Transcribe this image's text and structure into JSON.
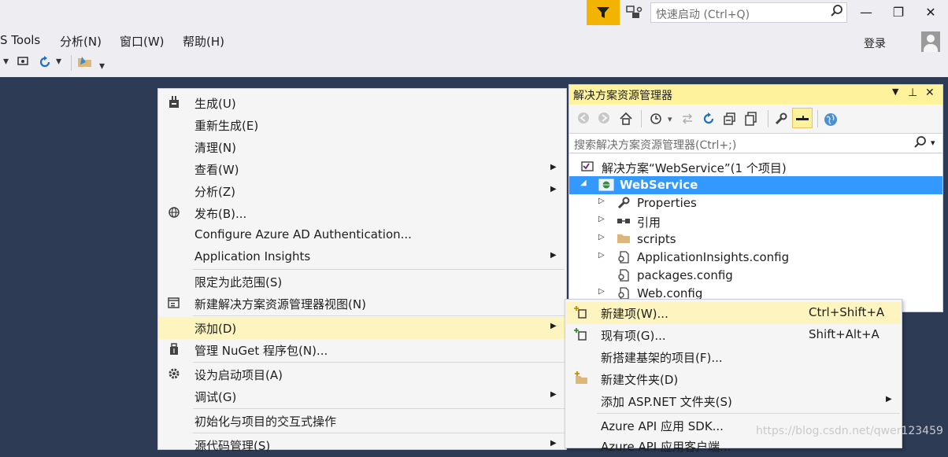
{
  "titlebar": {
    "quick_launch_placeholder": "快速启动 (Ctrl+Q)",
    "login_label": "登录",
    "minimize": "—",
    "maximize": "❐",
    "close": "✕"
  },
  "menubar": [
    "S Tools",
    "分析(N)",
    "窗口(W)",
    "帮助(H)"
  ],
  "context_menu": {
    "items": [
      {
        "label": "生成(U)",
        "icon": "build-icon",
        "arrow": ""
      },
      {
        "label": "重新生成(E)",
        "icon": "",
        "arrow": ""
      },
      {
        "label": "清理(N)",
        "icon": "",
        "arrow": ""
      },
      {
        "label": "查看(W)",
        "icon": "",
        "arrow": "▶"
      },
      {
        "label": "分析(Z)",
        "icon": "",
        "arrow": "▶"
      },
      {
        "label": "发布(B)...",
        "icon": "publish-globe-icon",
        "arrow": ""
      },
      {
        "label": "Configure Azure AD Authentication...",
        "icon": "",
        "arrow": ""
      },
      {
        "label": "Application Insights",
        "icon": "",
        "arrow": "▶"
      },
      {
        "label": "限定为此范围(S)",
        "icon": "",
        "arrow": ""
      },
      {
        "label": "新建解决方案资源管理器视图(N)",
        "icon": "new-view-icon",
        "arrow": ""
      },
      {
        "label": "添加(D)",
        "icon": "",
        "arrow": "▶"
      },
      {
        "label": "管理 NuGet 程序包(N)...",
        "icon": "nuget-icon",
        "arrow": ""
      },
      {
        "label": "设为启动项目(A)",
        "icon": "gear-icon",
        "arrow": ""
      },
      {
        "label": "调试(G)",
        "icon": "",
        "arrow": "▶"
      },
      {
        "label": "初始化与项目的交互式操作",
        "icon": "",
        "arrow": ""
      },
      {
        "label": "源代码管理(S)",
        "icon": "",
        "arrow": "▶"
      }
    ]
  },
  "solution_explorer": {
    "title": "解决方案资源管理器",
    "search_placeholder": "搜索解决方案资源管理器(Ctrl+;)",
    "tree": [
      {
        "label": "解决方案“WebService”(1 个项目)",
        "expander": "",
        "icon": "solution-icon"
      },
      {
        "label": "WebService",
        "expander": "◢",
        "icon": "web-project-icon"
      },
      {
        "label": "Properties",
        "expander": "▷",
        "icon": "wrench-icon"
      },
      {
        "label": "引用",
        "expander": "▷",
        "icon": "references-icon"
      },
      {
        "label": "scripts",
        "expander": "▷",
        "icon": "folder-icon"
      },
      {
        "label": "ApplicationInsights.config",
        "expander": "▷",
        "icon": "config-file-icon"
      },
      {
        "label": "packages.config",
        "expander": "",
        "icon": "config-file-icon"
      },
      {
        "label": "Web.config",
        "expander": "▷",
        "icon": "config-file-icon"
      }
    ]
  },
  "add_submenu": {
    "items": [
      {
        "label": "新建项(W)...",
        "shortcut": "Ctrl+Shift+A",
        "icon": "new-item-icon",
        "arrow": ""
      },
      {
        "label": "现有项(G)...",
        "shortcut": "Shift+Alt+A",
        "icon": "existing-item-icon",
        "arrow": ""
      },
      {
        "label": "新搭建基架的项目(F)...",
        "shortcut": "",
        "icon": "",
        "arrow": ""
      },
      {
        "label": "新建文件夹(D)",
        "shortcut": "",
        "icon": "new-folder-icon",
        "arrow": ""
      },
      {
        "label": "添加 ASP.NET 文件夹(S)",
        "shortcut": "",
        "icon": "",
        "arrow": "▶"
      },
      {
        "label": "Azure API 应用 SDK...",
        "shortcut": "",
        "icon": "",
        "arrow": ""
      },
      {
        "label": "Azure API 应用客户端...",
        "shortcut": "",
        "icon": "",
        "arrow": ""
      }
    ]
  },
  "watermark": "https://blog.csdn.net/qwer123459"
}
